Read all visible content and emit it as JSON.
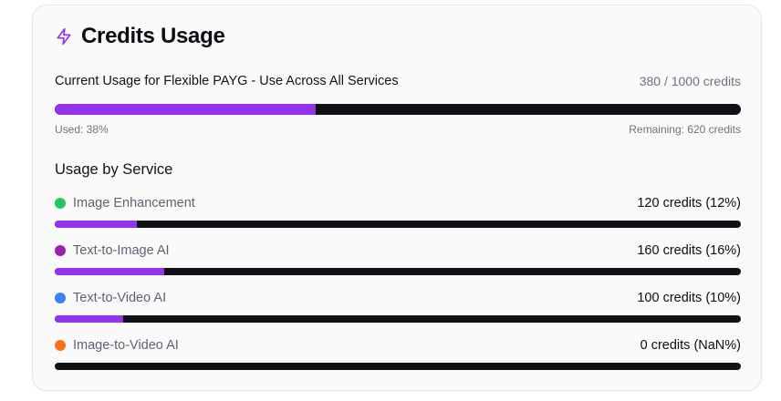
{
  "card": {
    "title": "Credits Usage",
    "icon": "lightning-bolt-icon",
    "accent_color": "#9333ea"
  },
  "usage": {
    "label": "Current Usage for Flexible PAYG - Use Across All Services",
    "total_text": "380 / 1000 credits",
    "used_fraction": 0.38,
    "used_text": "Used: 38%",
    "remaining_text": "Remaining: 620 credits"
  },
  "services": {
    "section_title": "Usage by Service",
    "items": [
      {
        "name": "Image Enhancement",
        "credits_text": "120 credits (12%)",
        "dot_color": "#22c55e",
        "fraction": 0.12
      },
      {
        "name": "Text-to-Image AI",
        "credits_text": "160 credits (16%)",
        "dot_color": "#a21caf",
        "fraction": 0.16
      },
      {
        "name": "Text-to-Video AI",
        "credits_text": "100 credits (10%)",
        "dot_color": "#3b82f6",
        "fraction": 0.1
      },
      {
        "name": "Image-to-Video AI",
        "credits_text": "0 credits (NaN%)",
        "dot_color": "#f97316",
        "fraction": 0
      }
    ]
  }
}
